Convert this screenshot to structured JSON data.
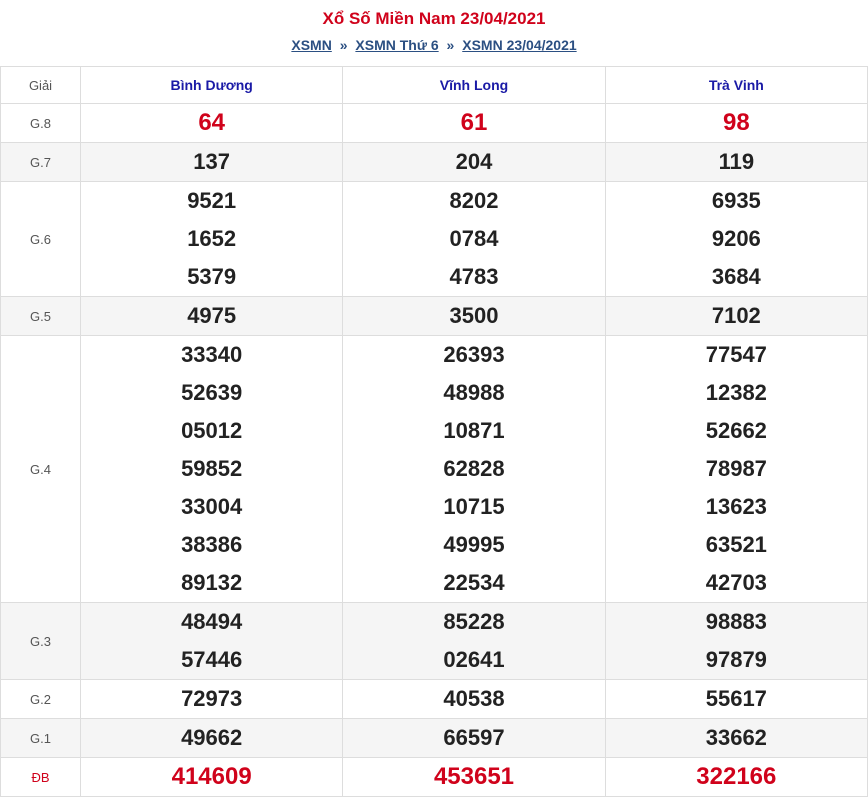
{
  "header": {
    "title": "Xổ Số Miền Nam 23/04/2021",
    "crumbs": [
      "XSMN",
      "XSMN Thứ 6",
      "XSMN 23/04/2021"
    ],
    "separator": "»"
  },
  "table": {
    "label_header": "Giải",
    "provinces": [
      "Bình Dương",
      "Vĩnh Long",
      "Trà Vinh"
    ],
    "rows": [
      {
        "label": "G.8",
        "values": [
          [
            "64"
          ],
          [
            "61"
          ],
          [
            "98"
          ]
        ]
      },
      {
        "label": "G.7",
        "values": [
          [
            "137"
          ],
          [
            "204"
          ],
          [
            "119"
          ]
        ]
      },
      {
        "label": "G.6",
        "values": [
          [
            "9521",
            "1652",
            "5379"
          ],
          [
            "8202",
            "0784",
            "4783"
          ],
          [
            "6935",
            "9206",
            "3684"
          ]
        ]
      },
      {
        "label": "G.5",
        "values": [
          [
            "4975"
          ],
          [
            "3500"
          ],
          [
            "7102"
          ]
        ]
      },
      {
        "label": "G.4",
        "values": [
          [
            "33340",
            "52639",
            "05012",
            "59852",
            "33004",
            "38386",
            "89132"
          ],
          [
            "26393",
            "48988",
            "10871",
            "62828",
            "10715",
            "49995",
            "22534"
          ],
          [
            "77547",
            "12382",
            "52662",
            "78987",
            "13623",
            "63521",
            "42703"
          ]
        ]
      },
      {
        "label": "G.3",
        "values": [
          [
            "48494",
            "57446"
          ],
          [
            "85228",
            "02641"
          ],
          [
            "98883",
            "97879"
          ]
        ]
      },
      {
        "label": "G.2",
        "values": [
          [
            "72973"
          ],
          [
            "40538"
          ],
          [
            "55617"
          ]
        ]
      },
      {
        "label": "G.1",
        "values": [
          [
            "49662"
          ],
          [
            "66597"
          ],
          [
            "33662"
          ]
        ]
      },
      {
        "label": "ĐB",
        "values": [
          [
            "414609"
          ],
          [
            "453651"
          ],
          [
            "322166"
          ]
        ]
      }
    ]
  },
  "colors": {
    "accent_red": "#d0021b",
    "link_blue": "#2b4f82",
    "province_blue": "#1a1aa6"
  }
}
